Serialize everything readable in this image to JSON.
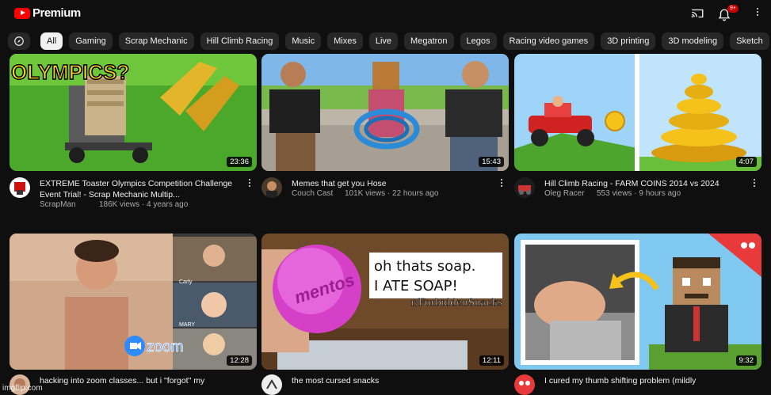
{
  "header": {
    "brand": "Premium",
    "notification_count": "9+"
  },
  "chips": [
    "All",
    "Gaming",
    "Scrap Mechanic",
    "Hill Climb Racing",
    "Music",
    "Mixes",
    "Live",
    "Megatron",
    "Legos",
    "Racing video games",
    "3D printing",
    "3D modeling",
    "Sketch"
  ],
  "videos": [
    {
      "title": "EXTREME Toaster Olympics Competition Challenge Event Trial! - Scrap Mechanic Multip...",
      "channel": "ScrapMan",
      "stats": "186K views · 4 years ago",
      "duration": "23:36",
      "thumb_text": "OLYMPICS?"
    },
    {
      "title": "Memes that get you Hose",
      "channel": "Couch Cast",
      "stats": "101K views · 22 hours ago",
      "duration": "15:43"
    },
    {
      "title": "Hill Climb Racing - FARM COINS 2014 vs 2024",
      "channel": "Oleg Racer",
      "stats": "553 views · 9 hours ago",
      "duration": "4:07"
    },
    {
      "title": "hacking into zoom classes... but i \"forgot\" my",
      "duration": "12:28",
      "labels": [
        "Carly",
        "MARY"
      ],
      "zoom_text": "zoom"
    },
    {
      "title": "the most cursed snacks",
      "duration": "12:11",
      "caption_line1": "oh thats soap.",
      "caption_line2": "I ATE SOAP!",
      "caption_source": "r/ForbiddenSnacks",
      "ball_text": "mentos"
    },
    {
      "title": "I cured my thumb shifting problem (mildly",
      "duration": "9:32"
    }
  ],
  "watermark": "imgflip.com"
}
